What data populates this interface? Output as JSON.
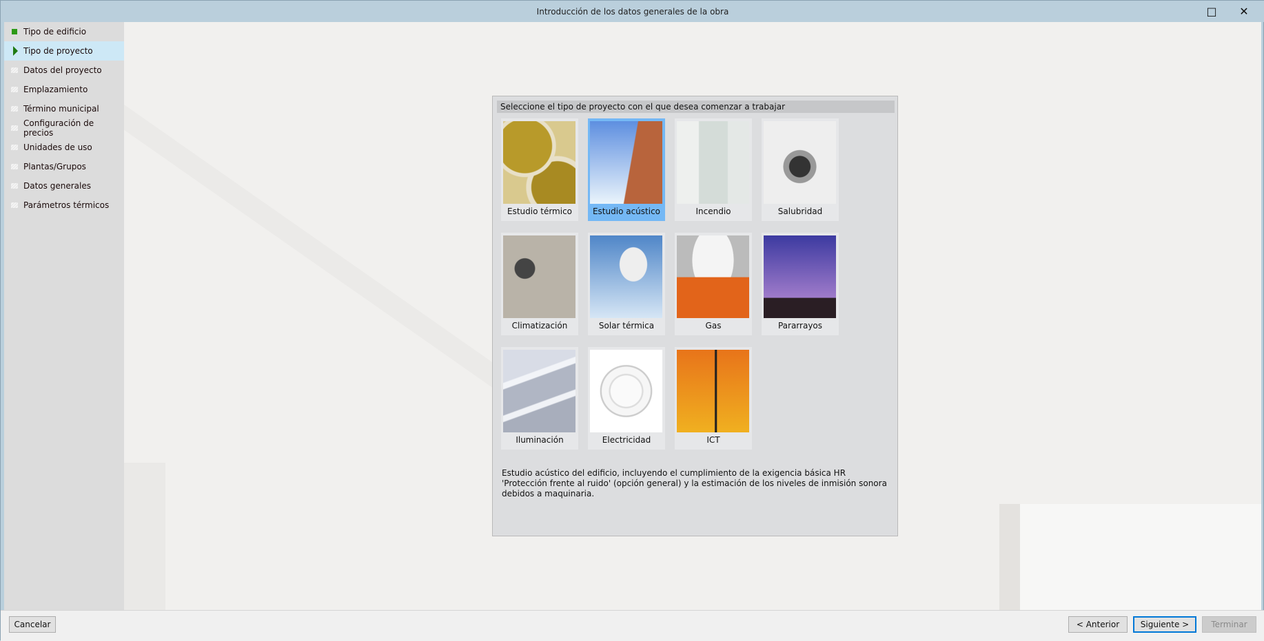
{
  "window": {
    "title": "Introducción de los datos generales de la obra",
    "maximize_icon": "□",
    "close_icon": "✕"
  },
  "sidebar": {
    "items": [
      {
        "label": "Tipo de edificio",
        "state": "done"
      },
      {
        "label": "Tipo de proyecto",
        "state": "current"
      },
      {
        "label": "Datos del proyecto",
        "state": "pending"
      },
      {
        "label": "Emplazamiento",
        "state": "pending"
      },
      {
        "label": "Término municipal",
        "state": "pending"
      },
      {
        "label": "Configuración de precios",
        "state": "pending"
      },
      {
        "label": "Unidades de uso",
        "state": "pending"
      },
      {
        "label": "Plantas/Grupos",
        "state": "pending"
      },
      {
        "label": "Datos generales",
        "state": "pending"
      },
      {
        "label": "Parámetros térmicos",
        "state": "pending"
      }
    ]
  },
  "panel": {
    "header": "Seleccione el tipo de proyecto con el que desea comenzar a trabajar",
    "tiles": [
      {
        "label": "Estudio térmico",
        "selected": false
      },
      {
        "label": "Estudio acústico",
        "selected": true
      },
      {
        "label": "Incendio",
        "selected": false
      },
      {
        "label": "Salubridad",
        "selected": false
      },
      {
        "label": "Climatización",
        "selected": false
      },
      {
        "label": "Solar térmica",
        "selected": false
      },
      {
        "label": "Gas",
        "selected": false
      },
      {
        "label": "Pararrayos",
        "selected": false
      },
      {
        "label": "Iluminación",
        "selected": false
      },
      {
        "label": "Electricidad",
        "selected": false
      },
      {
        "label": "ICT",
        "selected": false
      }
    ],
    "description": "Estudio acústico del edificio, incluyendo el cumplimiento de la exigencia básica HR 'Protección frente al ruido' (opción general) y la estimación de los niveles de inmisión sonora debidos a maquinaria."
  },
  "buttons": {
    "cancel": "Cancelar",
    "previous": "< Anterior",
    "next": "Siguiente >",
    "finish": "Terminar"
  },
  "colors": {
    "selected_tile": "#74b8f5",
    "done": "#2c9a17",
    "focus": "#0078d7"
  }
}
